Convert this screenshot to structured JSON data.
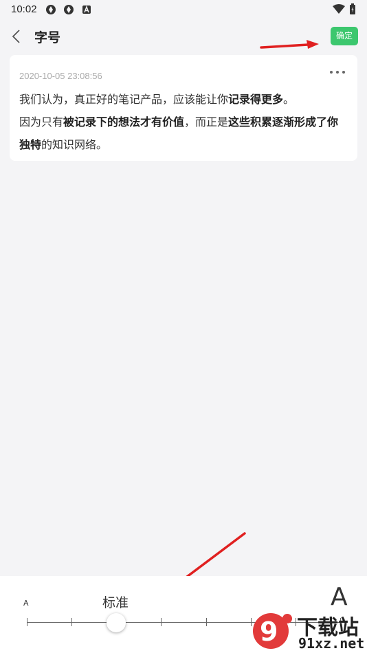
{
  "status_bar": {
    "time": "10:02"
  },
  "app_bar": {
    "title": "字号",
    "confirm_label": "确定"
  },
  "note": {
    "timestamp": "2020-10-05 23:08:56",
    "line1_a": "我们认为，真正好的笔记产品，应该能让你",
    "line1_b": "记录得更多",
    "line1_c": "。",
    "line2_a": "因为只有",
    "line2_b": "被记录下的想法才有价值",
    "line2_c": "，而正是",
    "line2_d": "这些积累逐渐形成了你独特",
    "line2_e": "的知识网络。"
  },
  "font_size": {
    "small_label": "A",
    "large_label": "A",
    "current_label": "标准",
    "level_index": 2,
    "levels_total": 8
  },
  "watermark": {
    "text1": "下载站",
    "text2": "91xz.net"
  },
  "colors": {
    "confirm": "#3cc76e",
    "arrow": "#e02020",
    "background": "#f4f4f6"
  }
}
